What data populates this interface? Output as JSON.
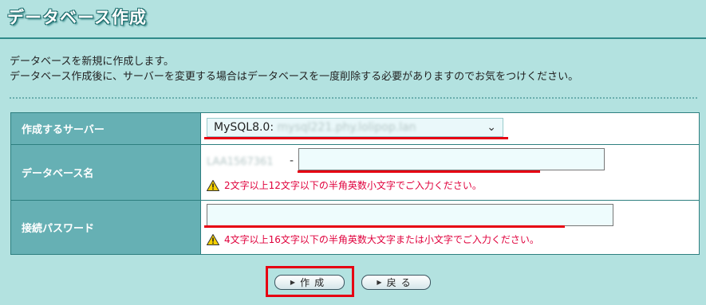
{
  "header": {
    "title": "データベース作成"
  },
  "description": {
    "line1": "データベースを新規に作成します。",
    "line2": "データベース作成後に、サーバーを変更する場合はデータベースを一度削除する必要がありますのでお気をつけください。"
  },
  "form": {
    "server": {
      "label": "作成するサーバー",
      "selected_prefix": "MySQL8.0:",
      "selected_host": "mysql221.phy.lolipop.lan"
    },
    "db_name": {
      "label": "データベース名",
      "prefix": "LAA1567361",
      "separator": "-",
      "value": "",
      "note": "2文字以上12文字以下の半角英数小文字でご入力ください。"
    },
    "password": {
      "label": "接続パスワード",
      "value": "",
      "note": "4文字以上16文字以下の半角英数大文字または小文字でご入力ください。"
    }
  },
  "buttons": {
    "create": "作成",
    "back": "戻る"
  },
  "colors": {
    "background": "#b3e2e0",
    "label_bg": "#66b0b4",
    "highlight": "#e60012",
    "note": "#e0003c"
  }
}
